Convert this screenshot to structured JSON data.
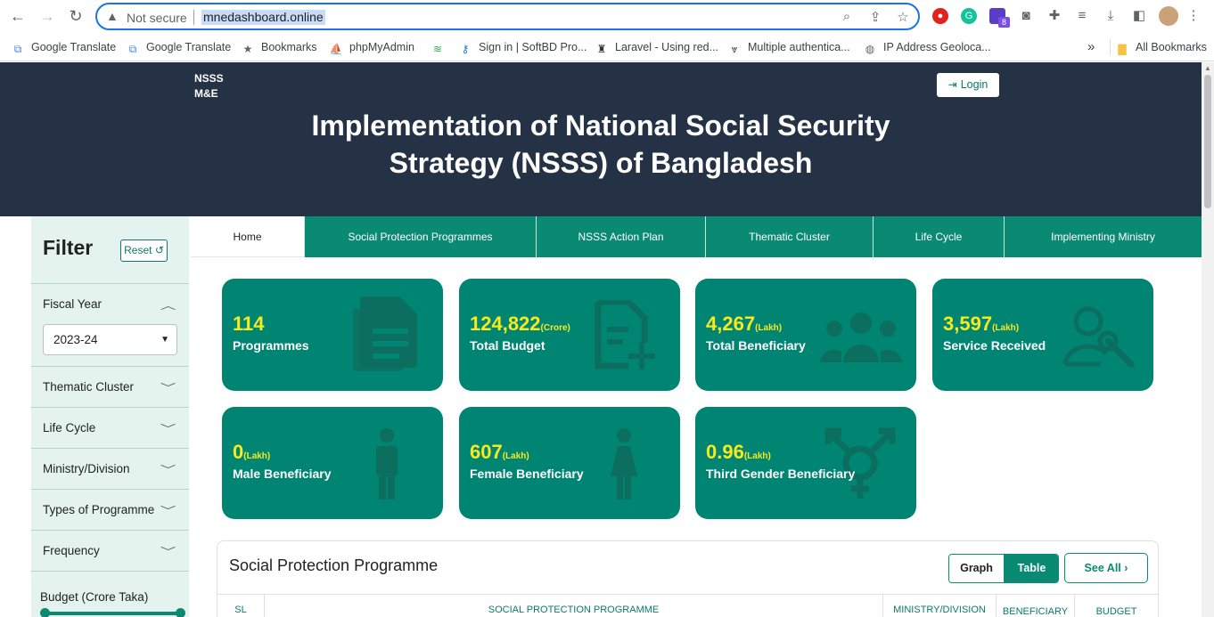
{
  "browser": {
    "security_label": "Not secure",
    "url": "mnedashboard.online",
    "bookmarks": [
      "Google Translate",
      "Google Translate",
      "Bookmarks",
      "phpMyAdmin",
      "",
      "Sign in | SoftBD Pro...",
      "Laravel - Using red...",
      "Multiple authentica...",
      "IP Address Geoloca..."
    ],
    "overflow_label": "»",
    "all_bookmarks": "All Bookmarks",
    "extension_badge": "8"
  },
  "header": {
    "brand_line1": "NSSS",
    "brand_line2": "M&E",
    "login_label": "Login",
    "title_line1": "Implementation of National Social Security",
    "title_line2": "Strategy (NSSS) of Bangladesh"
  },
  "sidebar": {
    "title": "Filter",
    "reset_label": "Reset",
    "fiscal_year_label": "Fiscal Year",
    "fiscal_year_value": "2023-24",
    "items": [
      "Thematic Cluster",
      "Life Cycle",
      "Ministry/Division",
      "Types of Programme",
      "Frequency"
    ],
    "budget_label": "Budget (Crore Taka)"
  },
  "tabs": [
    "Home",
    "Social Protection Programmes",
    "NSSS Action Plan",
    "Thematic Cluster",
    "Life Cycle",
    "Implementing Ministry"
  ],
  "cards": [
    {
      "value": "114",
      "unit": "",
      "label": "Programmes",
      "icon": "document-icon"
    },
    {
      "value": "124,822",
      "unit": "(Crore)",
      "label": "Total Budget",
      "icon": "budget-document-icon"
    },
    {
      "value": "4,267",
      "unit": "(Lakh)",
      "label": "Total Beneficiary",
      "icon": "people-icon"
    },
    {
      "value": "3,597",
      "unit": "(Lakh)",
      "label": "Service Received",
      "icon": "user-wrench-icon"
    },
    {
      "value": "0",
      "unit": "(Lakh)",
      "label": "Male Beneficiary",
      "icon": "male-icon"
    },
    {
      "value": "607",
      "unit": "(Lakh)",
      "label": "Female Beneficiary",
      "icon": "female-icon"
    },
    {
      "value": "0.96",
      "unit": "(Lakh)",
      "label": "Third Gender Beneficiary",
      "icon": "transgender-icon"
    }
  ],
  "programme_panel": {
    "title": "Social Protection Programme",
    "graph_label": "Graph",
    "table_label": "Table",
    "see_all_label": "See All",
    "columns": [
      "SL",
      "SOCIAL PROTECTION PROGRAMME",
      "MINISTRY/DIVISION",
      "BENEFICIARY",
      "BUDGET"
    ]
  },
  "colors": {
    "header_bg": "#253145",
    "accent": "#0b8a73",
    "card_bg": "#008573",
    "highlight": "#f7ea1e",
    "sidebar_bg": "#e5f3ef"
  }
}
